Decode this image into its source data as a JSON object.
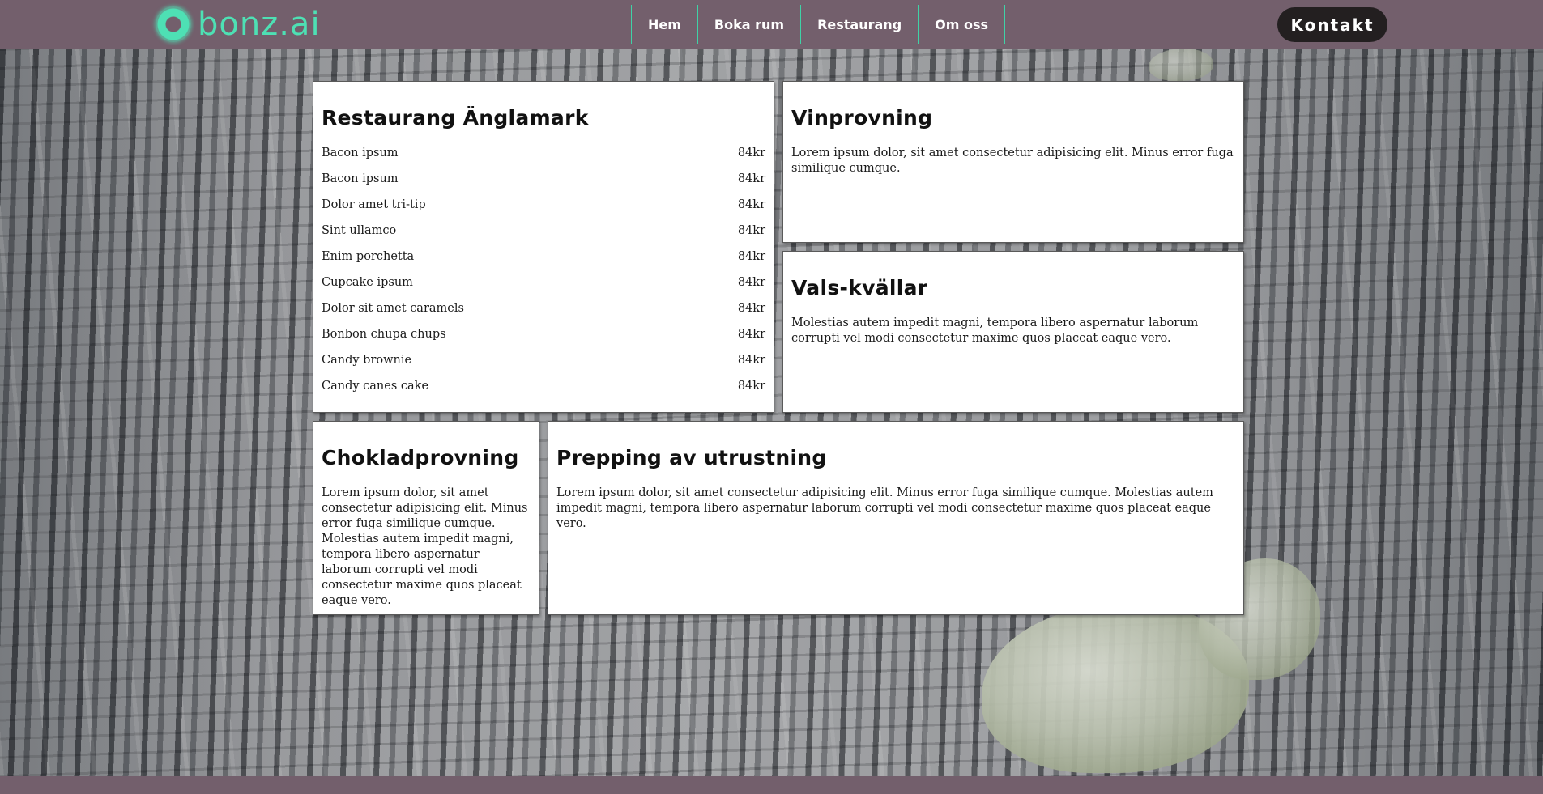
{
  "brand": {
    "name": "bonz.ai",
    "accent": "#4ee0b4",
    "header_bg": "#735f6c"
  },
  "nav": {
    "items": [
      {
        "label": "Hem"
      },
      {
        "label": "Boka rum"
      },
      {
        "label": "Restaurang"
      },
      {
        "label": "Om oss"
      }
    ],
    "contact_label": "Kontakt"
  },
  "restaurant": {
    "title": "Restaurang Änglamark",
    "menu": [
      {
        "name": "Bacon ipsum",
        "price": "84kr"
      },
      {
        "name": "Bacon ipsum",
        "price": "84kr"
      },
      {
        "name": "Dolor amet tri-tip",
        "price": "84kr"
      },
      {
        "name": "Sint ullamco",
        "price": "84kr"
      },
      {
        "name": "Enim porchetta",
        "price": "84kr"
      },
      {
        "name": "Cupcake ipsum",
        "price": "84kr"
      },
      {
        "name": "Dolor sit amet caramels",
        "price": "84kr"
      },
      {
        "name": "Bonbon chupa chups",
        "price": "84kr"
      },
      {
        "name": "Candy brownie",
        "price": "84kr"
      },
      {
        "name": "Candy canes cake",
        "price": "84kr"
      }
    ]
  },
  "vinprovning": {
    "title": "Vinprovning",
    "text": "Lorem ipsum dolor, sit amet consectetur adipisicing elit. Minus error fuga similique cumque."
  },
  "vals": {
    "title": "Vals-kvällar",
    "text": "Molestias autem impedit magni, tempora libero aspernatur laborum corrupti vel modi consectetur maxime quos placeat eaque vero."
  },
  "choklad": {
    "title": "Chokladprovning",
    "text": "Lorem ipsum dolor, sit amet consectetur adipisicing elit. Minus error fuga similique cumque. Molestias autem impedit magni, tempora libero aspernatur laborum corrupti vel modi consectetur maxime quos placeat eaque vero."
  },
  "prepping": {
    "title": "Prepping av utrustning",
    "text": "Lorem ipsum dolor, sit amet consectetur adipisicing elit. Minus error fuga similique cumque. Molestias autem impedit magni, tempora libero aspernatur laborum corrupti vel modi consectetur maxime quos placeat eaque vero."
  }
}
